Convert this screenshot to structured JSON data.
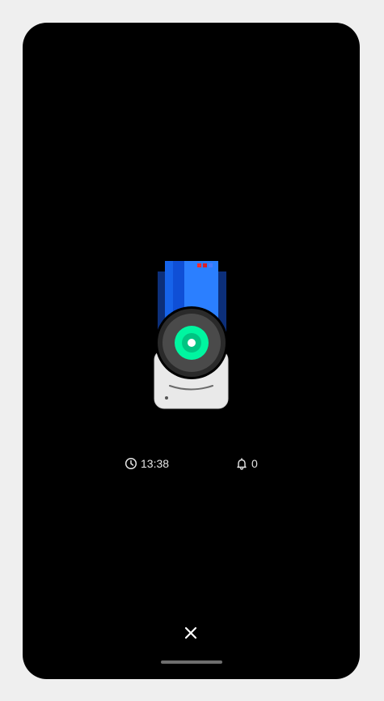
{
  "status": {
    "time": "13:38",
    "alert_count": "0"
  },
  "icons": {
    "time": "clock-icon",
    "alerts": "bell-icon",
    "close": "close-icon",
    "illustration": "security-camera-illustration"
  },
  "colors": {
    "screen_background": "#000000",
    "page_background": "#efefef",
    "camera_body_blue": "#2b7fff",
    "camera_lens_ring": "#00f5a0",
    "text": "#e6e6e6"
  }
}
